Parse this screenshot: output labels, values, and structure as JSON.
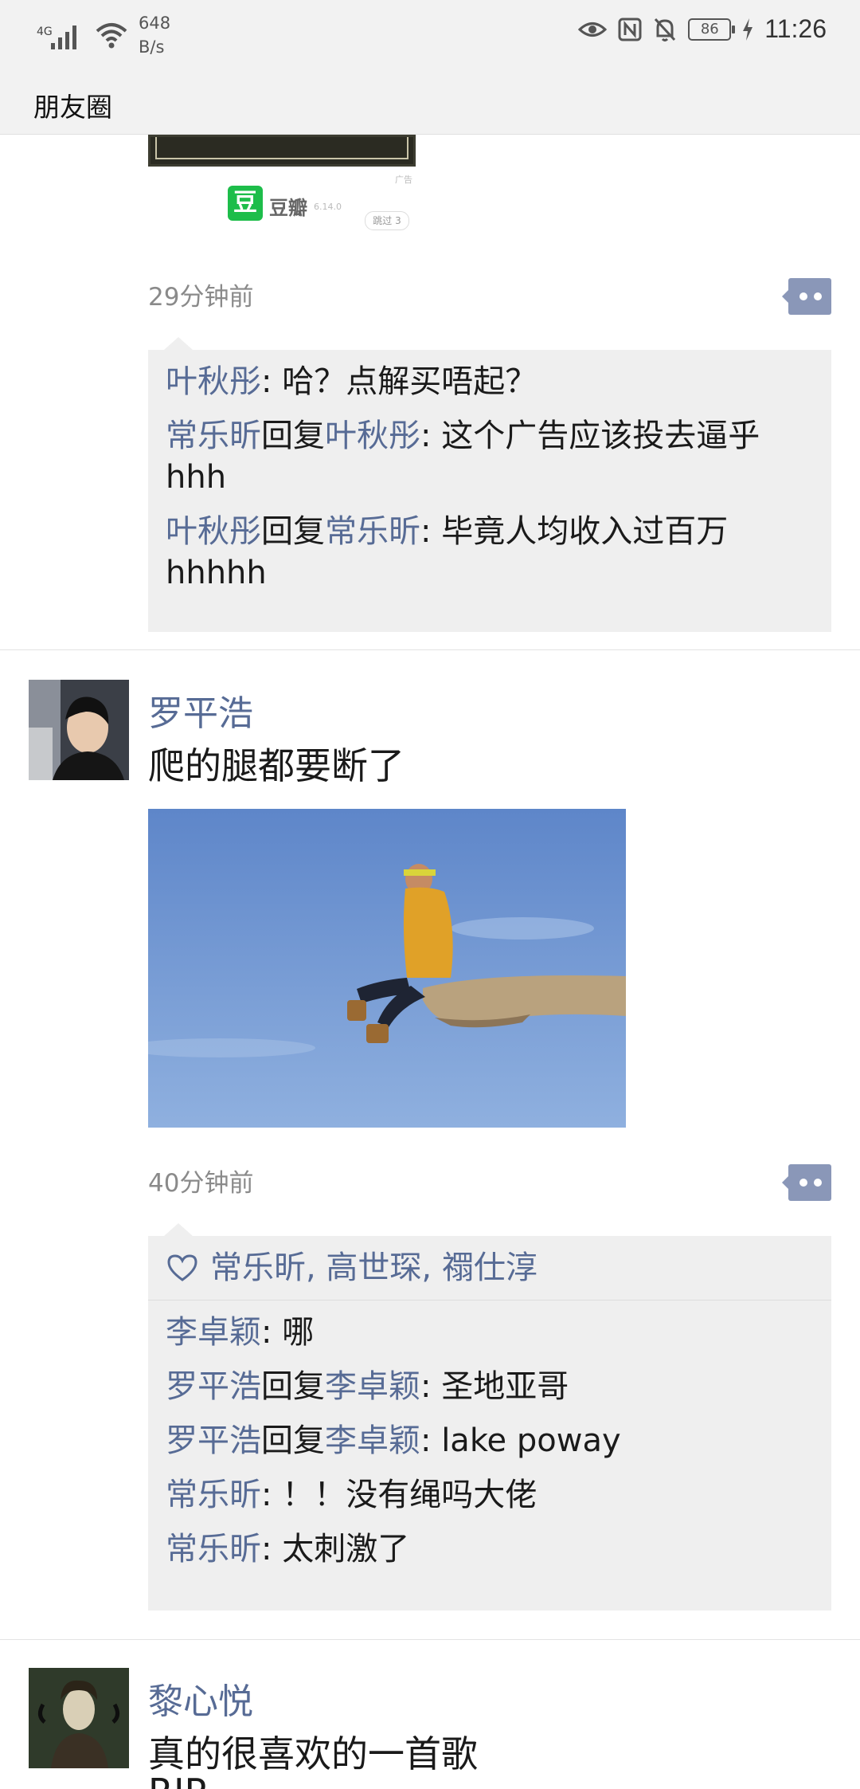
{
  "status_bar": {
    "network": "4G",
    "speed_value": "648",
    "speed_unit": "B/s",
    "battery": "86",
    "time": "11:26"
  },
  "nav": {
    "title": "朋友圈"
  },
  "ad": {
    "mark": "广告",
    "app_name": "豆瓣",
    "logo_char": "豆",
    "version": "6.14.0",
    "skip": "跳过 3"
  },
  "post1": {
    "time": "29分钟前",
    "comments": [
      {
        "from": "叶秋彤",
        "to": "",
        "text": ": 哈？点解买唔起？"
      },
      {
        "from": "常乐昕",
        "to": "叶秋彤",
        "text": ": 这个广告应该投去逼乎hhh"
      },
      {
        "from": "叶秋彤",
        "to": "常乐昕",
        "text": ": 毕竟人均收入过百万hhhhh"
      }
    ]
  },
  "post2": {
    "author": "罗平浩",
    "text": "爬的腿都要断了",
    "time": "40分钟前",
    "likes": "常乐昕, 高世琛, 禤仕淳",
    "comments": [
      {
        "from": "李卓颖",
        "to": "",
        "text": ": 哪"
      },
      {
        "from": "罗平浩",
        "to": "李卓颖",
        "text": ": 圣地亚哥"
      },
      {
        "from": "罗平浩",
        "to": "李卓颖",
        "text": ": lake poway"
      },
      {
        "from": "常乐昕",
        "to": "",
        "text": ": ！！没有绳吗大佬"
      },
      {
        "from": "常乐昕",
        "to": "",
        "text": ": 太刺激了"
      }
    ]
  },
  "post3": {
    "author": "黎心悦",
    "text": "真的很喜欢的一首歌",
    "text2": "RIP"
  },
  "reply_word": "回复",
  "colors": {
    "name_link": "#576b95",
    "comment_bg": "#efefef",
    "more_button": "#8a97b8"
  },
  "icons": [
    "signal-icon",
    "wifi-icon",
    "eye-icon",
    "nfc-icon",
    "mute-icon",
    "battery-icon",
    "charging-icon",
    "more-icon",
    "heart-icon"
  ]
}
